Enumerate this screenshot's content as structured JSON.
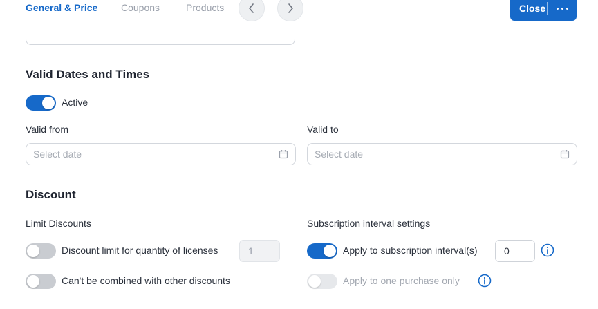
{
  "stepper": {
    "steps": [
      {
        "label": "General & Price",
        "state": "active"
      },
      {
        "label": "Coupons",
        "state": "inactive"
      },
      {
        "label": "Products",
        "state": "inactive"
      }
    ],
    "prev_icon": "chevron-left-icon",
    "next_icon": "chevron-right-icon"
  },
  "header": {
    "close_label": "Close",
    "more_icon": "more-horizontal-icon"
  },
  "valid_dates": {
    "title": "Valid Dates and Times",
    "active_toggle": {
      "label": "Active",
      "on": true
    },
    "valid_from": {
      "label": "Valid from",
      "placeholder": "Select date",
      "icon": "calendar-icon"
    },
    "valid_to": {
      "label": "Valid to",
      "placeholder": "Select date",
      "icon": "calendar-icon"
    }
  },
  "discount": {
    "title": "Discount",
    "limit_discounts": {
      "heading": "Limit Discounts",
      "quantity_limit": {
        "label": "Discount limit for quantity of licenses",
        "on": false,
        "value": "1"
      },
      "not_combinable": {
        "label": "Can't be combined with other discounts",
        "on": false
      }
    },
    "subscription": {
      "heading": "Subscription interval settings",
      "apply_interval": {
        "label": "Apply to subscription interval(s)",
        "on": true,
        "value": "0",
        "icon": "info-icon"
      },
      "one_purchase": {
        "label": "Apply to one purchase only",
        "on": false,
        "disabled": true,
        "icon": "info-icon"
      }
    }
  },
  "colors": {
    "accent": "#1669c9",
    "toggle_off": "#c9ccd1",
    "muted_text": "#9aa0ab"
  }
}
